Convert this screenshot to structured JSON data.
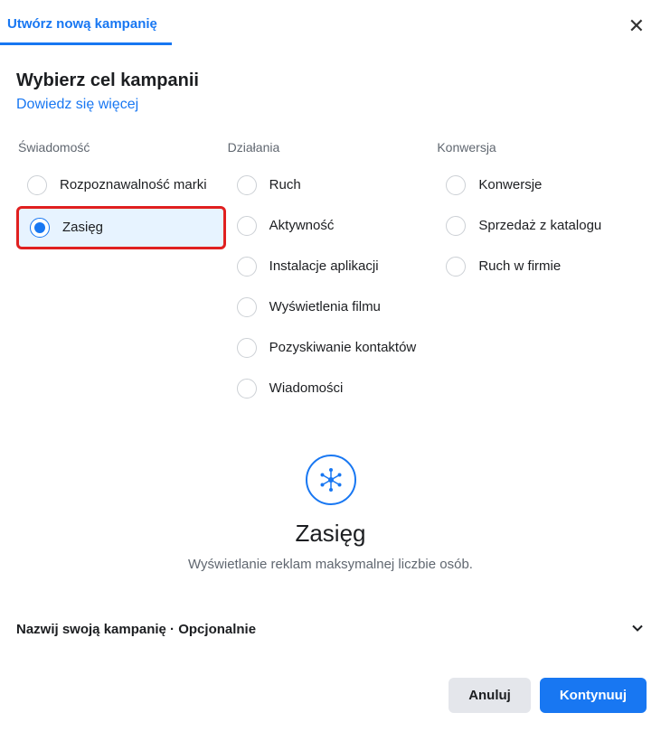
{
  "header": {
    "tab_label": "Utwórz nową kampanię"
  },
  "section": {
    "title": "Wybierz cel kampanii",
    "learn_more": "Dowiedz się więcej"
  },
  "columns": {
    "awareness": {
      "header": "Świadomość",
      "options": [
        {
          "label": "Rozpoznawalność marki",
          "selected": false
        },
        {
          "label": "Zasięg",
          "selected": true
        }
      ]
    },
    "consideration": {
      "header": "Działania",
      "options": [
        {
          "label": "Ruch",
          "selected": false
        },
        {
          "label": "Aktywność",
          "selected": false
        },
        {
          "label": "Instalacje aplikacji",
          "selected": false
        },
        {
          "label": "Wyświetlenia filmu",
          "selected": false
        },
        {
          "label": "Pozyskiwanie kontaktów",
          "selected": false
        },
        {
          "label": "Wiadomości",
          "selected": false
        }
      ]
    },
    "conversion": {
      "header": "Konwersja",
      "options": [
        {
          "label": "Konwersje",
          "selected": false
        },
        {
          "label": "Sprzedaż z katalogu",
          "selected": false
        },
        {
          "label": "Ruch w firmie",
          "selected": false
        }
      ]
    }
  },
  "preview": {
    "title": "Zasięg",
    "description": "Wyświetlanie reklam maksymalnej liczbie osób."
  },
  "name_section": {
    "label": "Nazwij swoją kampanię · Opcjonalnie"
  },
  "footer": {
    "cancel": "Anuluj",
    "continue": "Kontynuuj"
  }
}
